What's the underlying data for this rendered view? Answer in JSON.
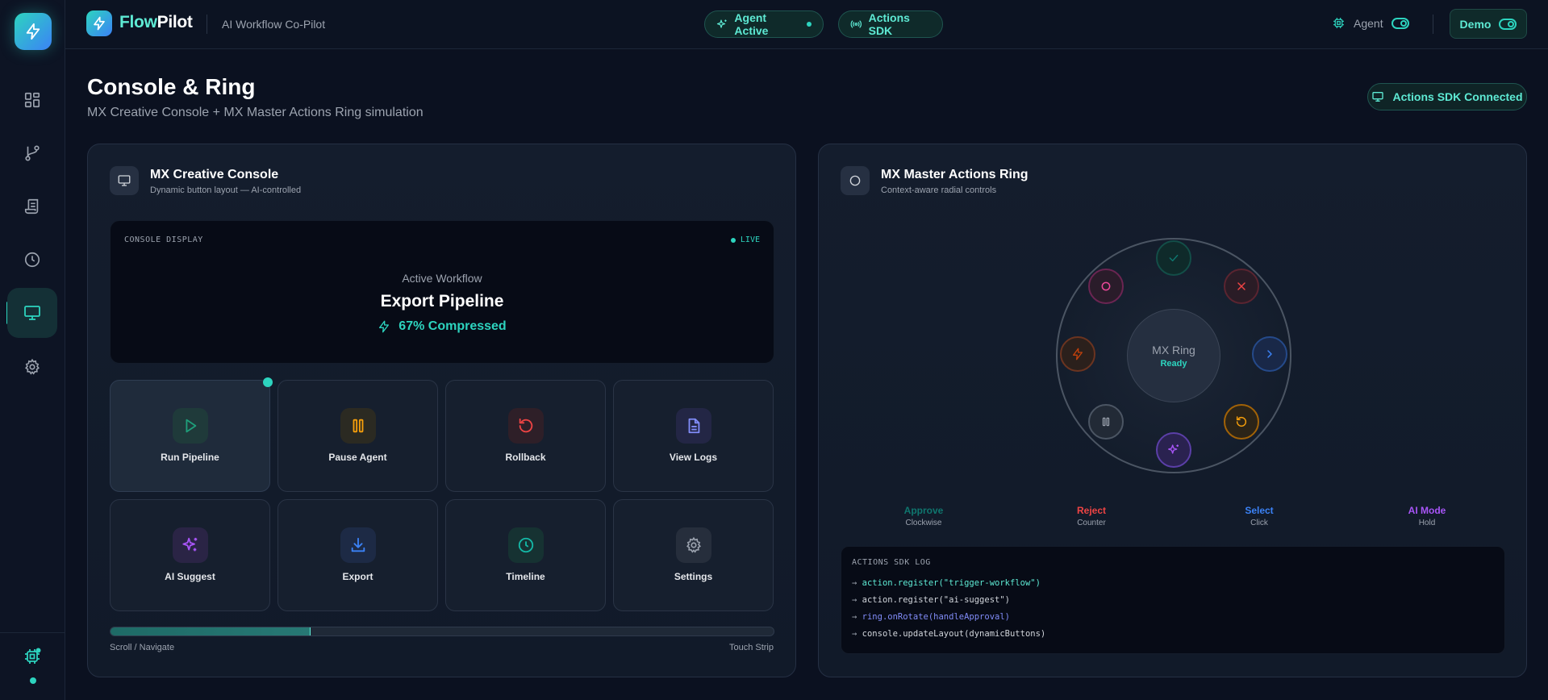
{
  "brand": {
    "name_part1": "Flow",
    "name_part2": "Pilot",
    "subtitle": "AI Workflow Co-Pilot"
  },
  "header": {
    "agent_pill": "Agent Active",
    "sdk_pill": "Actions SDK",
    "agent_toggle_label": "Agent",
    "demo_label": "Demo"
  },
  "sidebar": {
    "items": [
      {
        "name": "dashboard",
        "icon": "grid-icon"
      },
      {
        "name": "workflows",
        "icon": "branch-icon"
      },
      {
        "name": "logs",
        "icon": "scroll-icon"
      },
      {
        "name": "history",
        "icon": "clock-icon"
      },
      {
        "name": "console",
        "icon": "monitor-icon",
        "active": true
      },
      {
        "name": "settings",
        "icon": "gear-icon"
      }
    ],
    "footer_icon": "chip-icon"
  },
  "page": {
    "title": "Console & Ring",
    "subtitle": "MX Creative Console + MX Master Actions Ring simulation",
    "status": "Actions SDK Connected"
  },
  "console": {
    "title": "MX Creative Console",
    "subtitle": "Dynamic button layout — AI-controlled",
    "display": {
      "label": "CONSOLE DISPLAY",
      "live": "LIVE",
      "workflow_label": "Active Workflow",
      "workflow_name": "Export Pipeline",
      "stat": "67% Compressed"
    },
    "buttons": [
      {
        "label": "Run Pipeline",
        "icon": "play-icon",
        "color": "#22c55e",
        "active": true
      },
      {
        "label": "Pause Agent",
        "icon": "pause-icon",
        "color": "#f59e0b"
      },
      {
        "label": "Rollback",
        "icon": "rollback-icon",
        "color": "#ef4444"
      },
      {
        "label": "View Logs",
        "icon": "file-icon",
        "color": "#818cf8"
      },
      {
        "label": "AI Suggest",
        "icon": "sparkle-icon",
        "color": "#a855f7"
      },
      {
        "label": "Export",
        "icon": "download-icon",
        "color": "#3b82f6"
      },
      {
        "label": "Timeline",
        "icon": "clock-icon",
        "color": "#14b8a6"
      },
      {
        "label": "Settings",
        "icon": "gear-icon",
        "color": "#9ca3af"
      }
    ],
    "touch_strip": {
      "progress": 0.3,
      "left_label": "Scroll / Navigate",
      "right_label": "Touch Strip"
    }
  },
  "ring": {
    "title": "MX Master Actions Ring",
    "subtitle": "Context-aware radial controls",
    "center_title": "MX Ring",
    "center_status": "Ready",
    "buttons": [
      {
        "name": "approve",
        "icon": "check-icon",
        "color": "#14b8a6"
      },
      {
        "name": "reject",
        "icon": "close-icon",
        "color": "#ef4444"
      },
      {
        "name": "select",
        "icon": "chevron-right-icon",
        "color": "#3b82f6"
      },
      {
        "name": "rollback",
        "icon": "rollback-icon",
        "color": "#f59e0b"
      },
      {
        "name": "ai-mode",
        "icon": "sparkle-icon",
        "color": "#a855f7"
      },
      {
        "name": "pause",
        "icon": "pause-icon",
        "color": "#9ca3af"
      },
      {
        "name": "trigger",
        "icon": "bolt-icon",
        "color": "#f97316"
      },
      {
        "name": "record",
        "icon": "circle-icon",
        "color": "#ec4899"
      }
    ],
    "legend": [
      {
        "name": "Approve",
        "sub": "Clockwise",
        "color": "#0f766e"
      },
      {
        "name": "Reject",
        "sub": "Counter",
        "color": "#ef4444"
      },
      {
        "name": "Select",
        "sub": "Click",
        "color": "#3b82f6"
      },
      {
        "name": "AI Mode",
        "sub": "Hold",
        "color": "#a855f7"
      }
    ],
    "log": {
      "title": "ACTIONS SDK LOG",
      "lines": [
        {
          "text": "action.register(\"trigger-workflow\")",
          "color": "#5eead4"
        },
        {
          "text": "action.register(\"ai-suggest\")",
          "color": "#d1d5db"
        },
        {
          "text": "ring.onRotate(handleApproval)",
          "color": "#818cf8"
        },
        {
          "text": "console.updateLayout(dynamicButtons)",
          "color": "#d1d5db"
        }
      ]
    }
  }
}
